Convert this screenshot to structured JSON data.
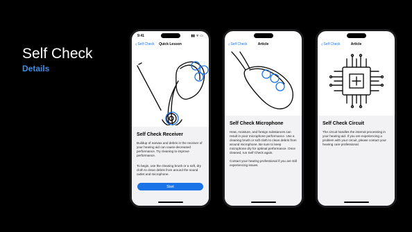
{
  "slide": {
    "title": "Self Check",
    "subtitle": "Details"
  },
  "phones": [
    {
      "status_time": "9:41",
      "status_icons": "▮▮ ᯤ ▭",
      "nav": {
        "back_label": "Self Check",
        "title": "Quick Lesson"
      },
      "heading": "Self Check Receiver",
      "paragraphs": [
        "Buildup of earwax and debris in the receiver of your hearing aid can cause decreased performance. Try cleaning to improve performance.",
        "To begin, use the cleaning brush or a soft, dry cloth to clean debris from around the sound outlet and microphone."
      ],
      "button_label": "Start"
    },
    {
      "status_time": "",
      "status_icons": "",
      "nav": {
        "back_label": "Self Check",
        "title": "Article"
      },
      "heading": "Self Check Microphone",
      "paragraphs": [
        "Heat, moisture, and foreign substances can result in poor microphone performance. Use a cleaning brush or soft cloth to clean debris from around microphone. Be sure to keep microphone dry for optimal performance. Once cleaned, run Self Check again.",
        "Contact your hearing professional if you are still experiencing issues."
      ]
    },
    {
      "status_time": "",
      "status_icons": "",
      "nav": {
        "back_label": "Self Check",
        "title": "Article"
      },
      "heading": "Self Check Circuit",
      "paragraphs": [
        "The circuit handles the internal processing in your hearing aid. If you are experiencing a problem with your circuit, please contact your hearing care professional."
      ]
    }
  ]
}
